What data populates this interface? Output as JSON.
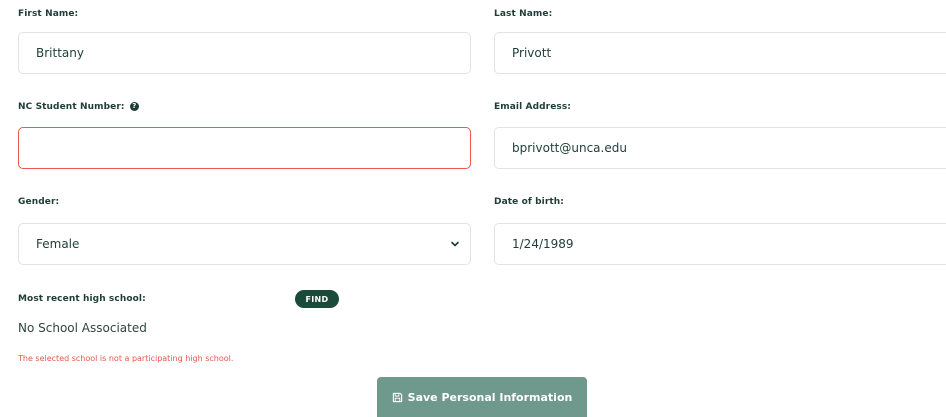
{
  "form": {
    "first_name": {
      "label": "First Name:",
      "value": "Brittany"
    },
    "last_name": {
      "label": "Last Name:",
      "value": "Privott"
    },
    "student_number": {
      "label": "NC Student Number:",
      "help_icon": "?",
      "value": ""
    },
    "email": {
      "label": "Email Address:",
      "value": "bprivott@unca.edu"
    },
    "gender": {
      "label": "Gender:",
      "value": "Female"
    },
    "dob": {
      "label": "Date of birth:",
      "value": "1/24/1989"
    },
    "high_school": {
      "label": "Most recent high school:",
      "find_label": "FIND",
      "value": "No School Associated",
      "error": "The selected school is not a participating high school."
    },
    "save_label": "Save Personal Information"
  },
  "colors": {
    "primary": "#1c4a3a",
    "button_disabled": "#6f998c",
    "error": "#e8554a",
    "border": "#e2e4e3"
  }
}
